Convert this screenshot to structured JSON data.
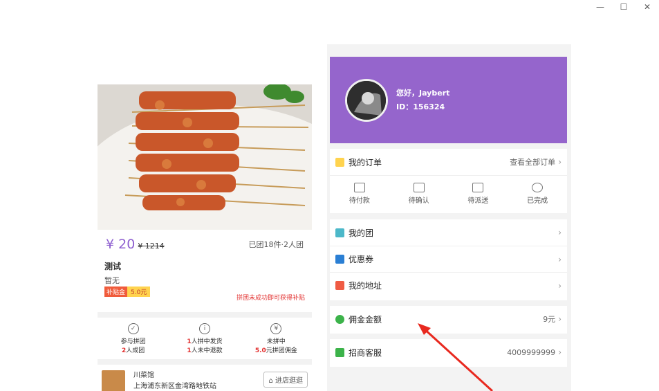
{
  "window": {
    "minimize_glyph": "—",
    "maximize_glyph": "☐",
    "close_glyph": "✕"
  },
  "product": {
    "price": "¥ 20",
    "original_price": "¥ 1214",
    "sold": "已团18件·2人团",
    "title": "测试",
    "desc": "暂无",
    "tag_a": "补贴金",
    "tag_b": "5.0元",
    "notice": "拼团未成功即可获得补贴",
    "steps": [
      {
        "icon": "✓",
        "l1": "参与拼团",
        "l2_red": "2",
        "l2": "人成团"
      },
      {
        "icon": "i",
        "l1_red": "1",
        "l1": "人拼中发货",
        "l2_red": "1",
        "l2": "人未中退款"
      },
      {
        "icon": "¥",
        "l1": "未拼中",
        "l2_red": "5.0",
        "l2": "元拼团佣金"
      }
    ],
    "shop_name": "川菜馆",
    "shop_addr": "上海浦东新区金湾路地铁站",
    "shop_btn": "进店逛逛"
  },
  "profile": {
    "greeting": "您好，Jaybert",
    "id": "ID：156324",
    "banner_color": "#9565cc"
  },
  "orders": {
    "label": "我的订单",
    "view_all": "查看全部订单",
    "items": [
      "待付款",
      "待确认",
      "待派送",
      "已完成"
    ]
  },
  "menu": {
    "group": "我的团",
    "coupon": "优惠券",
    "address": "我的地址",
    "commission": "佣金金额",
    "commission_value": "9元",
    "service": "招商客服",
    "service_value": "4009999999"
  }
}
